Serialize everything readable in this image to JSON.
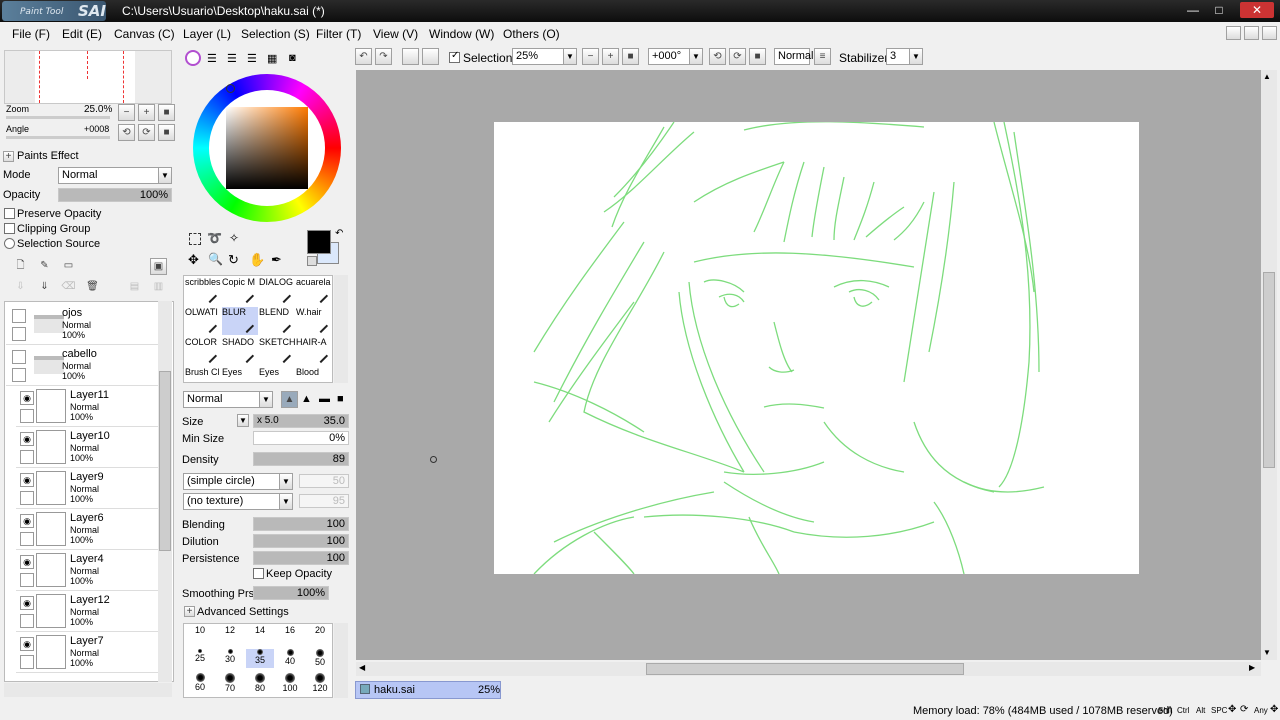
{
  "window": {
    "title": "C:\\Users\\Usuario\\Desktop\\haku.sai (*)",
    "logo_small": "Paint Tool",
    "logo_big": "SAI",
    "min": "—",
    "max": "□",
    "close": "✕"
  },
  "menu": [
    "File (F)",
    "Edit (E)",
    "Canvas (C)",
    "Layer (L)",
    "Selection (S)",
    "Filter (T)",
    "View (V)",
    "Window (W)",
    "Others (O)"
  ],
  "toolbar": {
    "selection_label": "Selection",
    "selection_checked": true,
    "zoom": "25%",
    "angle": "+000°",
    "blend_mode": "Normal",
    "stabilizer_label": "Stabilizer",
    "stabilizer": "3"
  },
  "navigator": {
    "zoom_label": "Zoom",
    "zoom_value": "25.0%",
    "angle_label": "Angle",
    "angle_value": "+0008"
  },
  "paints_effect": {
    "header": "Paints Effect",
    "mode_label": "Mode",
    "mode_value": "Normal",
    "opacity_label": "Opacity",
    "opacity_value": "100%",
    "preserve_opacity": "Preserve Opacity",
    "clipping_group": "Clipping Group",
    "selection_source": "Selection Source"
  },
  "layers": [
    {
      "name": "ojos",
      "mode": "Normal",
      "opacity": "100%",
      "folder": true
    },
    {
      "name": "cabello",
      "mode": "Normal",
      "opacity": "100%",
      "folder": true
    },
    {
      "name": "Layer11",
      "mode": "Normal",
      "opacity": "100%",
      "folder": false
    },
    {
      "name": "Layer10",
      "mode": "Normal",
      "opacity": "100%",
      "folder": false
    },
    {
      "name": "Layer9",
      "mode": "Normal",
      "opacity": "100%",
      "folder": false
    },
    {
      "name": "Layer6",
      "mode": "Normal",
      "opacity": "100%",
      "folder": false
    },
    {
      "name": "Layer4",
      "mode": "Normal",
      "opacity": "100%",
      "folder": false
    },
    {
      "name": "Layer12",
      "mode": "Normal",
      "opacity": "100%",
      "folder": false
    },
    {
      "name": "Layer7",
      "mode": "Normal",
      "opacity": "100%",
      "folder": false
    }
  ],
  "brushes": [
    [
      "scribbles",
      "Copic M",
      "DIALOG",
      "acuarela"
    ],
    [
      "OLWATI",
      "BLUR",
      "BLEND",
      "W.hair"
    ],
    [
      "COLOR",
      "SHADO",
      "SKETCH",
      "HAIR-A"
    ],
    [
      "Brush Cl",
      "Eyes",
      "Eyes",
      "Blood"
    ]
  ],
  "tool": {
    "blend_mode": "Normal",
    "size_label": "Size",
    "size_mult": "x 5.0",
    "size_value": "35.0",
    "min_size_label": "Min Size",
    "min_size_value": "0%",
    "density_label": "Density",
    "density_value": "89",
    "shape": "(simple circle)",
    "shape_value": "50",
    "texture": "(no texture)",
    "texture_value": "95",
    "blending_label": "Blending",
    "blending_value": "100",
    "dilution_label": "Dilution",
    "dilution_value": "100",
    "persistence_label": "Persistence",
    "persistence_value": "100",
    "keep_opacity": "Keep Opacity",
    "smoothing_label": "Smoothing Prs",
    "smoothing_value": "100%",
    "advanced": "Advanced Settings"
  },
  "brush_sizes": [
    "10",
    "12",
    "14",
    "16",
    "20",
    "25",
    "30",
    "35",
    "40",
    "50",
    "60",
    "70",
    "80",
    "100",
    "120"
  ],
  "document_tab": {
    "name": "haku.sai",
    "zoom": "25%"
  },
  "status": {
    "memory": "Memory load: 78% (484MB used / 1078MB reserved)",
    "keys": [
      "Shft",
      "Ctrl",
      "Alt",
      "SPC",
      "Any"
    ]
  },
  "colors": {
    "primary": "#000000",
    "secondary": "#dbe8fb",
    "sketch_line": "#7ddc7d"
  }
}
